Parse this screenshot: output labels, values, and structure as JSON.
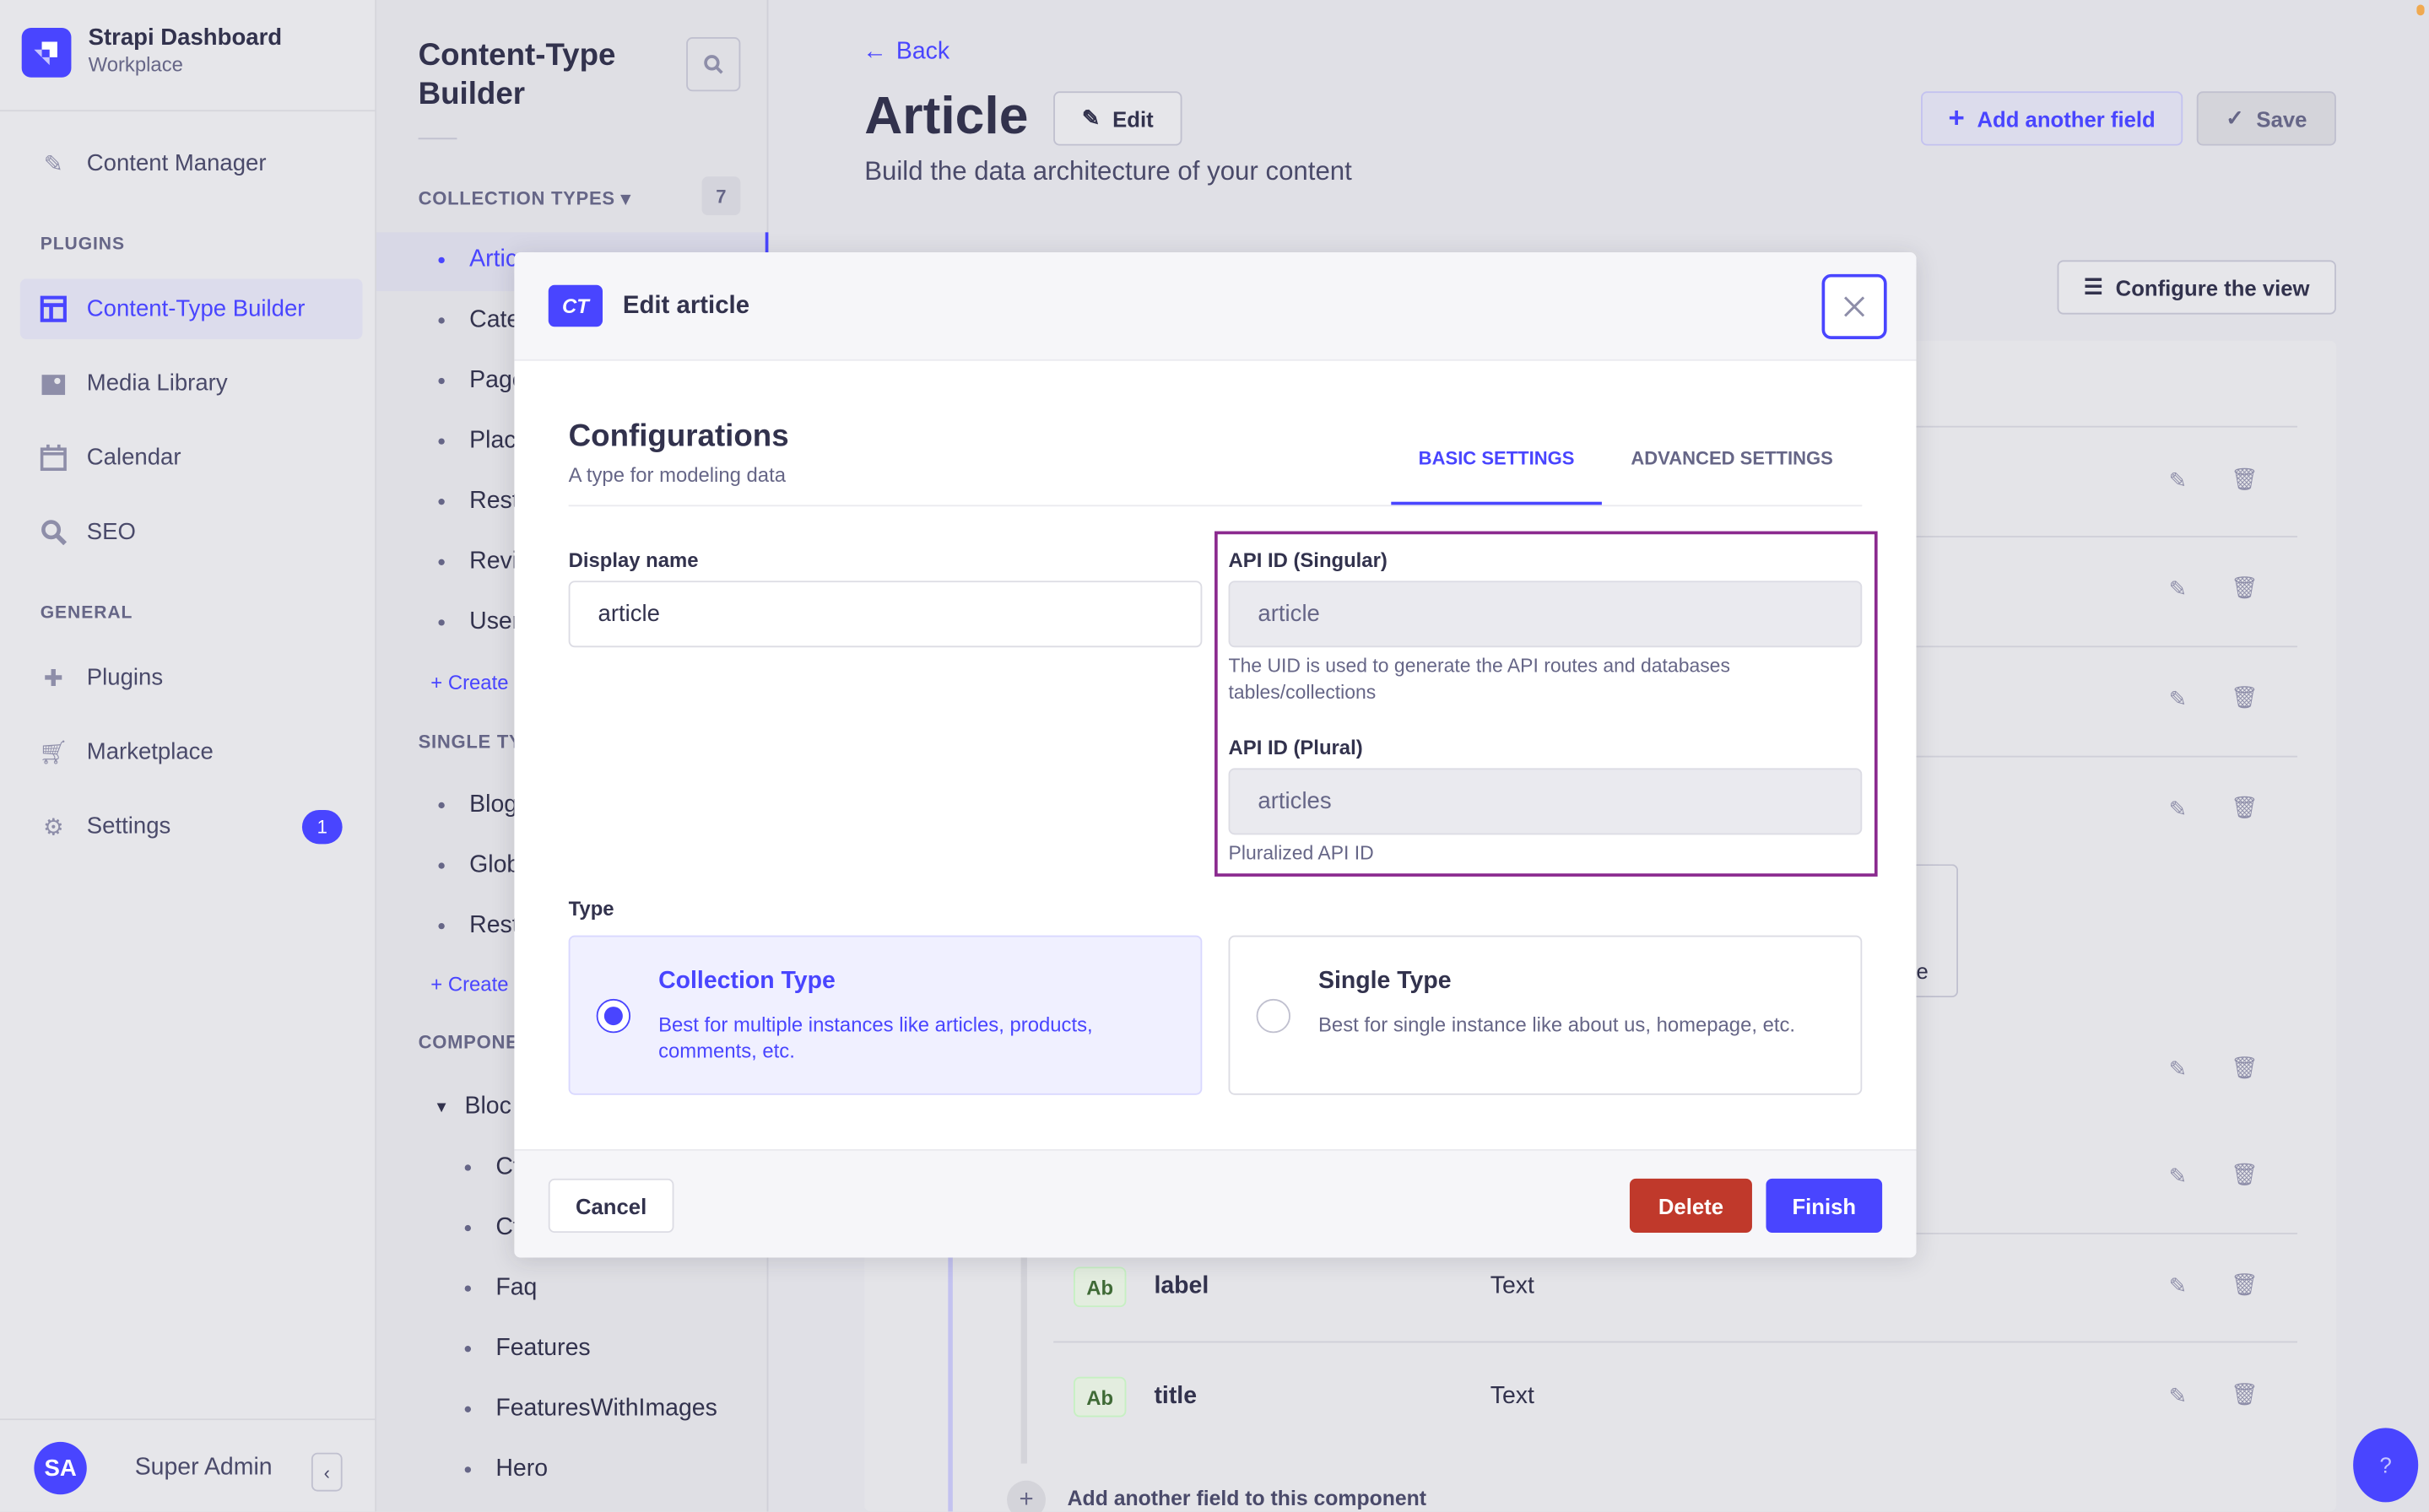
{
  "sidebar": {
    "brand_title": "Strapi Dashboard",
    "brand_subtitle": "Workplace",
    "content_manager": "Content Manager",
    "plugins_heading": "PLUGINS",
    "plugins": [
      {
        "label": "Content-Type Builder",
        "icon": "layout-icon"
      },
      {
        "label": "Media Library",
        "icon": "image-icon"
      },
      {
        "label": "Calendar",
        "icon": "calendar-icon"
      },
      {
        "label": "SEO",
        "icon": "search-icon"
      }
    ],
    "general_heading": "GENERAL",
    "general": [
      {
        "label": "Plugins",
        "icon": "puzzle-icon"
      },
      {
        "label": "Marketplace",
        "icon": "cart-icon"
      },
      {
        "label": "Settings",
        "icon": "gear-icon",
        "badge": "1"
      }
    ],
    "user_initials": "SA",
    "user_name": "Super Admin"
  },
  "subnav": {
    "title_line1": "Content-Type",
    "title_line2": "Builder",
    "collection_heading": "COLLECTION TYPES",
    "collection_count": "7",
    "collection_items": [
      "Artic",
      "Cate",
      "Page",
      "Plac",
      "Rest",
      "Revi",
      "User"
    ],
    "create_label": "Create",
    "single_heading": "SINGLE TY",
    "single_items": [
      "Blog",
      "Glob",
      "Rest"
    ],
    "components_heading": "COMPONE",
    "component_group": "Bloc",
    "component_items": [
      "Ct",
      "Ct",
      "Faq",
      "Features",
      "FeaturesWithImages",
      "Hero"
    ]
  },
  "main": {
    "back": "Back",
    "title": "Article",
    "edit": "Edit",
    "subtitle": "Build the data architecture of your content",
    "add_field": "Add another field",
    "save": "Save",
    "configure": "Configure the view",
    "partial_text": "e",
    "fields": [
      {
        "name": "label",
        "type": "Text",
        "tag": "Ab"
      },
      {
        "name": "title",
        "type": "Text",
        "tag": "Ab"
      }
    ],
    "add_component_field": "Add another field to this component",
    "help": "?"
  },
  "modal": {
    "badge": "CT",
    "title": "Edit article",
    "heading": "Configurations",
    "subheading": "A type for modeling data",
    "tabs": [
      {
        "label": "BASIC SETTINGS",
        "active": true
      },
      {
        "label": "ADVANCED SETTINGS",
        "active": false
      }
    ],
    "display_name_label": "Display name",
    "display_name_value": "article",
    "api_singular_label": "API ID (Singular)",
    "api_singular_value": "article",
    "api_singular_hint": "The UID is used to generate the API routes and databases tables/collections",
    "api_plural_label": "API ID (Plural)",
    "api_plural_value": "articles",
    "api_plural_hint": "Pluralized API ID",
    "type_label": "Type",
    "types": [
      {
        "title": "Collection Type",
        "desc": "Best for multiple instances like articles, products, comments, etc.",
        "selected": true
      },
      {
        "title": "Single Type",
        "desc": "Best for single instance like about us, homepage, etc.",
        "selected": false
      }
    ],
    "cancel": "Cancel",
    "delete": "Delete",
    "finish": "Finish"
  },
  "colors": {
    "primary": "#4945ff",
    "danger": "#c0392b",
    "highlight": "#8b2a8f"
  }
}
